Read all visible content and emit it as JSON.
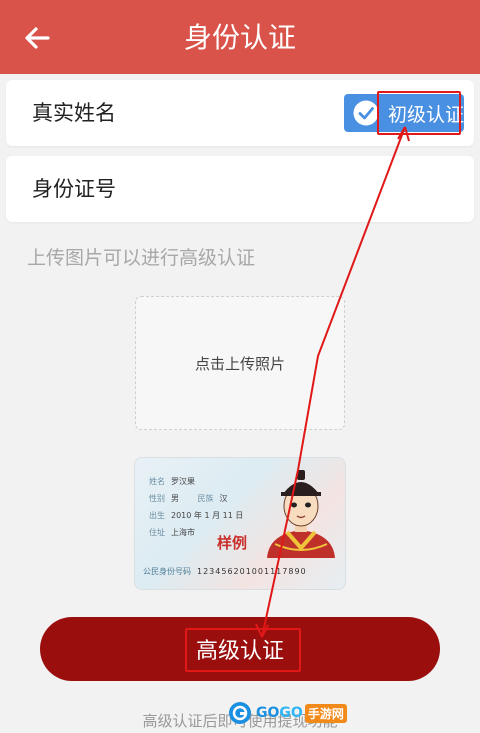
{
  "header": {
    "title": "身份认证"
  },
  "form": {
    "name_label": "真实姓名",
    "badge_label": "初级认证",
    "id_label": "身份证号"
  },
  "hint": "上传图片可以进行高级认证",
  "upload": {
    "label": "点击上传照片"
  },
  "sample_card": {
    "name_key": "姓名",
    "name_val": "罗汉果",
    "sex_key": "性别",
    "sex_val": "男",
    "nation_key": "民族",
    "nation_val": "汉",
    "birth_key": "出生",
    "birth_val": "2010 年 1 月 11 日",
    "addr_key": "住址",
    "addr_val": "上海市",
    "sample_mark": "样例",
    "number_key": "公民身份号码",
    "number_val": "123456201001117890"
  },
  "submit": {
    "label": "高级认证"
  },
  "footer_note": "高级认证后即可使用提现功能",
  "watermark": {
    "go1": "GO",
    "go2": "GO",
    "cn": "手游网"
  },
  "colors": {
    "header": "#d9534a",
    "badge": "#4a90e2",
    "button": "#9b0e0e",
    "annotation": "#e01818"
  }
}
